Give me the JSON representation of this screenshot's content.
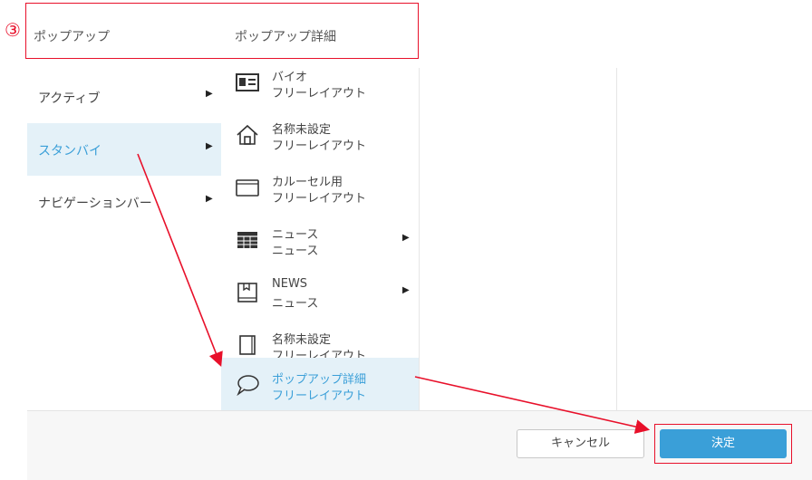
{
  "step_marker": "③",
  "header": {
    "col1_label": "ポップアップ",
    "col2_label": "ポップアップ詳細"
  },
  "categories": [
    {
      "label": "アクティブ",
      "has_submenu": true,
      "selected": false
    },
    {
      "label": "スタンバイ",
      "has_submenu": true,
      "selected": true
    },
    {
      "label": "ナビゲーションバー",
      "has_submenu": true,
      "selected": false
    }
  ],
  "templates": [
    {
      "icon": "id-card-icon",
      "title": "バイオ",
      "subtitle": "フリーレイアウト",
      "has_submenu": false,
      "selected": false
    },
    {
      "icon": "home-icon",
      "title": "名称未設定",
      "subtitle": "フリーレイアウト",
      "has_submenu": false,
      "selected": false
    },
    {
      "icon": "carousel-icon",
      "title": "カルーセル用",
      "subtitle": "フリーレイアウト",
      "has_submenu": false,
      "selected": false
    },
    {
      "icon": "table-icon",
      "title": "ニュース",
      "subtitle": "ニュース",
      "has_submenu": true,
      "selected": false
    },
    {
      "icon": "book-icon",
      "title": "NEWS",
      "subtitle": "ニュース",
      "has_submenu": true,
      "selected": false
    },
    {
      "icon": "page-icon",
      "title": "名称未設定",
      "subtitle": "フリーレイアウト",
      "has_submenu": false,
      "selected": false
    },
    {
      "icon": "speech-bubble-icon",
      "title": "ポップアップ詳細",
      "subtitle": "フリーレイアウト",
      "has_submenu": false,
      "selected": true
    }
  ],
  "footer": {
    "cancel_label": "キャンセル",
    "ok_label": "決定"
  },
  "colors": {
    "accent": "#3a9fd8",
    "annotation": "#e8102a",
    "selected_bg": "#e4f1f8"
  }
}
